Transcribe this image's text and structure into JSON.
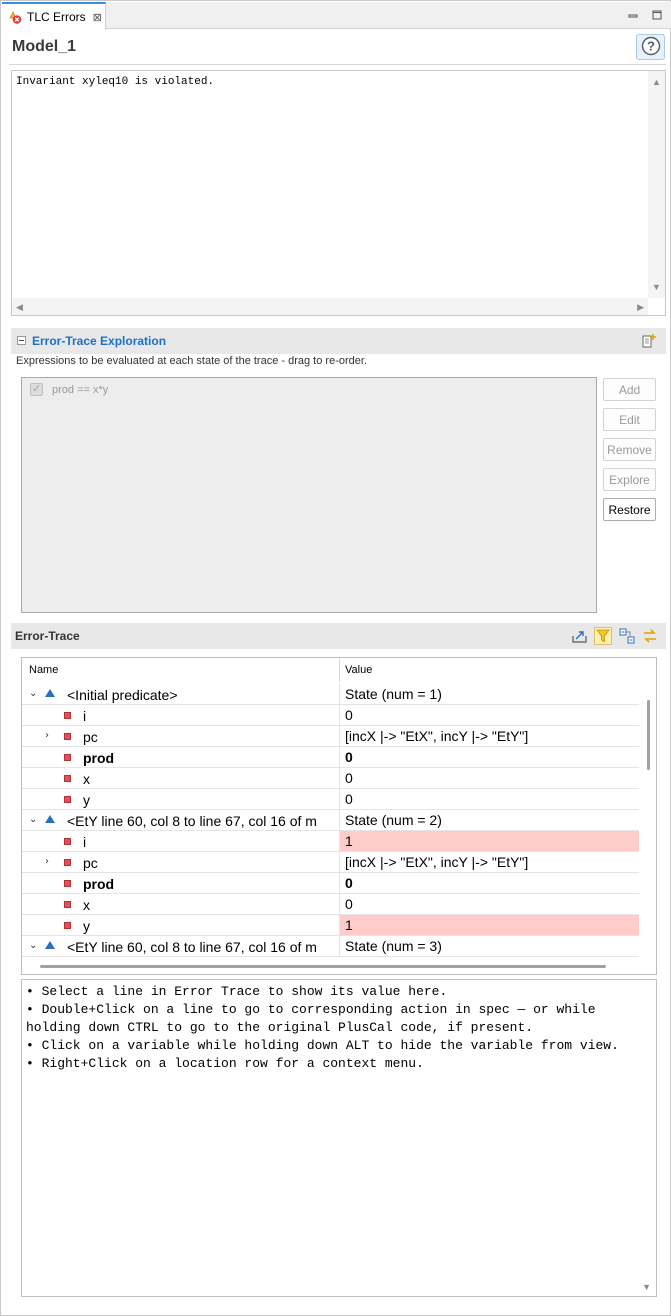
{
  "tab": {
    "label": "TLC Errors",
    "close": "⊠"
  },
  "model": {
    "title": "Model_1"
  },
  "error_message": "Invariant xyleq10 is violated.",
  "exploration": {
    "title": "Error-Trace Exploration",
    "description": "Expressions to be evaluated at each state of the trace - drag to re-order.",
    "expressions": [
      {
        "text": "prod == x*y",
        "checked": true
      }
    ],
    "buttons": {
      "add": "Add",
      "edit": "Edit",
      "remove": "Remove",
      "explore": "Explore",
      "restore": "Restore"
    }
  },
  "trace": {
    "title": "Error-Trace",
    "columns": {
      "name": "Name",
      "value": "Value"
    },
    "rows": [
      {
        "name": "<Initial predicate>",
        "value": "State (num = 1)"
      },
      {
        "name": "i",
        "value": "0"
      },
      {
        "name": "pc",
        "value": "[incX |-> \"EtX\", incY |-> \"EtY\"]"
      },
      {
        "name": "prod",
        "value": "0"
      },
      {
        "name": "x",
        "value": "0"
      },
      {
        "name": "y",
        "value": "0"
      },
      {
        "name": "<EtY line 60, col 8 to line 67, col 16 of m",
        "value": "State (num = 2)"
      },
      {
        "name": "i",
        "value": "1"
      },
      {
        "name": "pc",
        "value": "[incX |-> \"EtX\", incY |-> \"EtY\"]"
      },
      {
        "name": "prod",
        "value": "0"
      },
      {
        "name": "x",
        "value": "0"
      },
      {
        "name": "y",
        "value": "1"
      },
      {
        "name": "<EtY line 60, col 8 to line 67, col 16 of m",
        "value": "State (num = 3)"
      }
    ]
  },
  "help_text": "• Select a line in Error Trace to show its value here.\n• Double+Click on a line to go to corresponding action in spec — or while holding down CTRL to go to the original PlusCal code, if present.\n• Click on a variable while holding down ALT to hide the variable from view.\n• Right+Click on a location row for a context menu.",
  "icons": {
    "tab": "tlc-error-icon",
    "minimize": "minimize-icon",
    "maximize": "maximize-icon",
    "help": "help-icon",
    "add_expression": "add-expression-icon",
    "export": "export-icon",
    "filter": "filter-icon",
    "collapse_all": "collapse-all-icon",
    "sync": "sync-icon"
  },
  "colors": {
    "changed_value": "#ffcccc",
    "link_title": "#1f6fc5",
    "filter_active": "#fff1b0"
  }
}
